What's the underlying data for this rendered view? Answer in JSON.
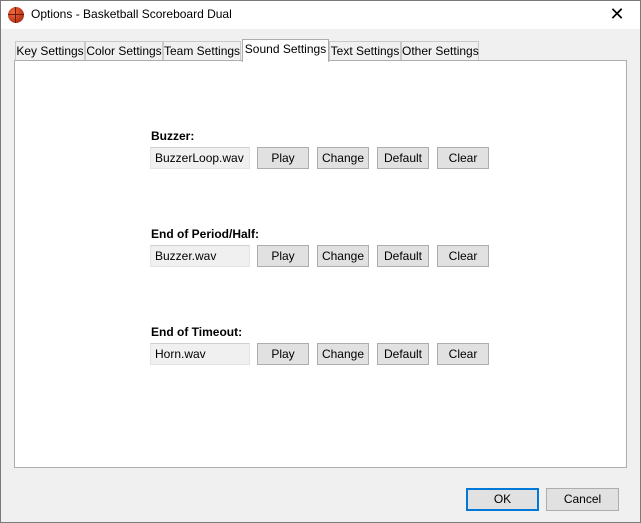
{
  "window": {
    "title": "Options - Basketball Scoreboard Dual",
    "close_glyph": "✕"
  },
  "tabs": [
    {
      "label": "Key Settings"
    },
    {
      "label": "Color Settings"
    },
    {
      "label": "Team Settings"
    },
    {
      "label": "Sound Settings",
      "active": true
    },
    {
      "label": "Text Settings"
    },
    {
      "label": "Other Settings"
    }
  ],
  "sounds": [
    {
      "label": "Buzzer:",
      "file": "BuzzerLoop.wav"
    },
    {
      "label": "End of Period/Half:",
      "file": "Buzzer.wav"
    },
    {
      "label": "End of Timeout:",
      "file": "Horn.wav"
    }
  ],
  "row_buttons": {
    "play": "Play",
    "change": "Change",
    "default": "Default",
    "clear": "Clear"
  },
  "footer": {
    "ok": "OK",
    "cancel": "Cancel"
  },
  "colors": {
    "ok_focus": "#0078d7",
    "app_icon": "#c0391b"
  },
  "icons": {
    "app": "basketball-icon",
    "close": "close-icon"
  }
}
